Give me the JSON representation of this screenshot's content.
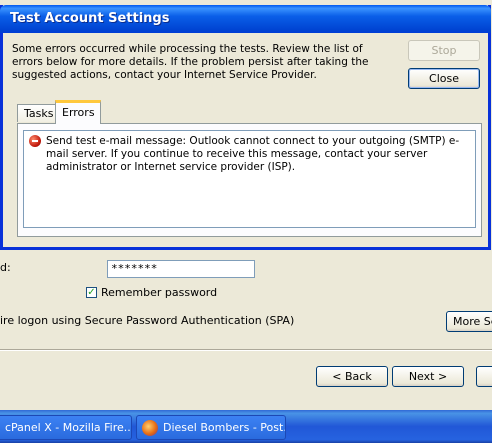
{
  "background_window": {
    "password_label": "d:",
    "password_value": "*******",
    "remember_label": "Remember password",
    "remember_checked": true,
    "spa_label": "ire logon using Secure Password Authentication (SPA)",
    "more_settings_label": "More Se",
    "back_label": "< Back",
    "next_label": "Next >"
  },
  "dialog": {
    "title": "Test Account Settings",
    "message": "Some errors occurred while processing the tests. Review the list of errors below for more details. If the problem persist after taking the suggested actions, contact your Internet Service Provider.",
    "stop_label": "Stop",
    "close_label": "Close",
    "tabs": [
      {
        "label": "Tasks",
        "active": false
      },
      {
        "label": "Errors",
        "active": true
      }
    ],
    "error_text": "Send test e-mail message: Outlook cannot connect to your outgoing (SMTP) e-mail server. If you continue to receive this message, contact your server administrator or Internet service provider (ISP)."
  },
  "taskbar": {
    "items": [
      {
        "label": "cPanel X - Mozilla Fire..."
      },
      {
        "label": "Diesel Bombers - Post..."
      }
    ]
  },
  "colors": {
    "title_bar": "#0a5ee8",
    "taskbar": "#2157d7",
    "window_bg": "#ece9d8"
  }
}
